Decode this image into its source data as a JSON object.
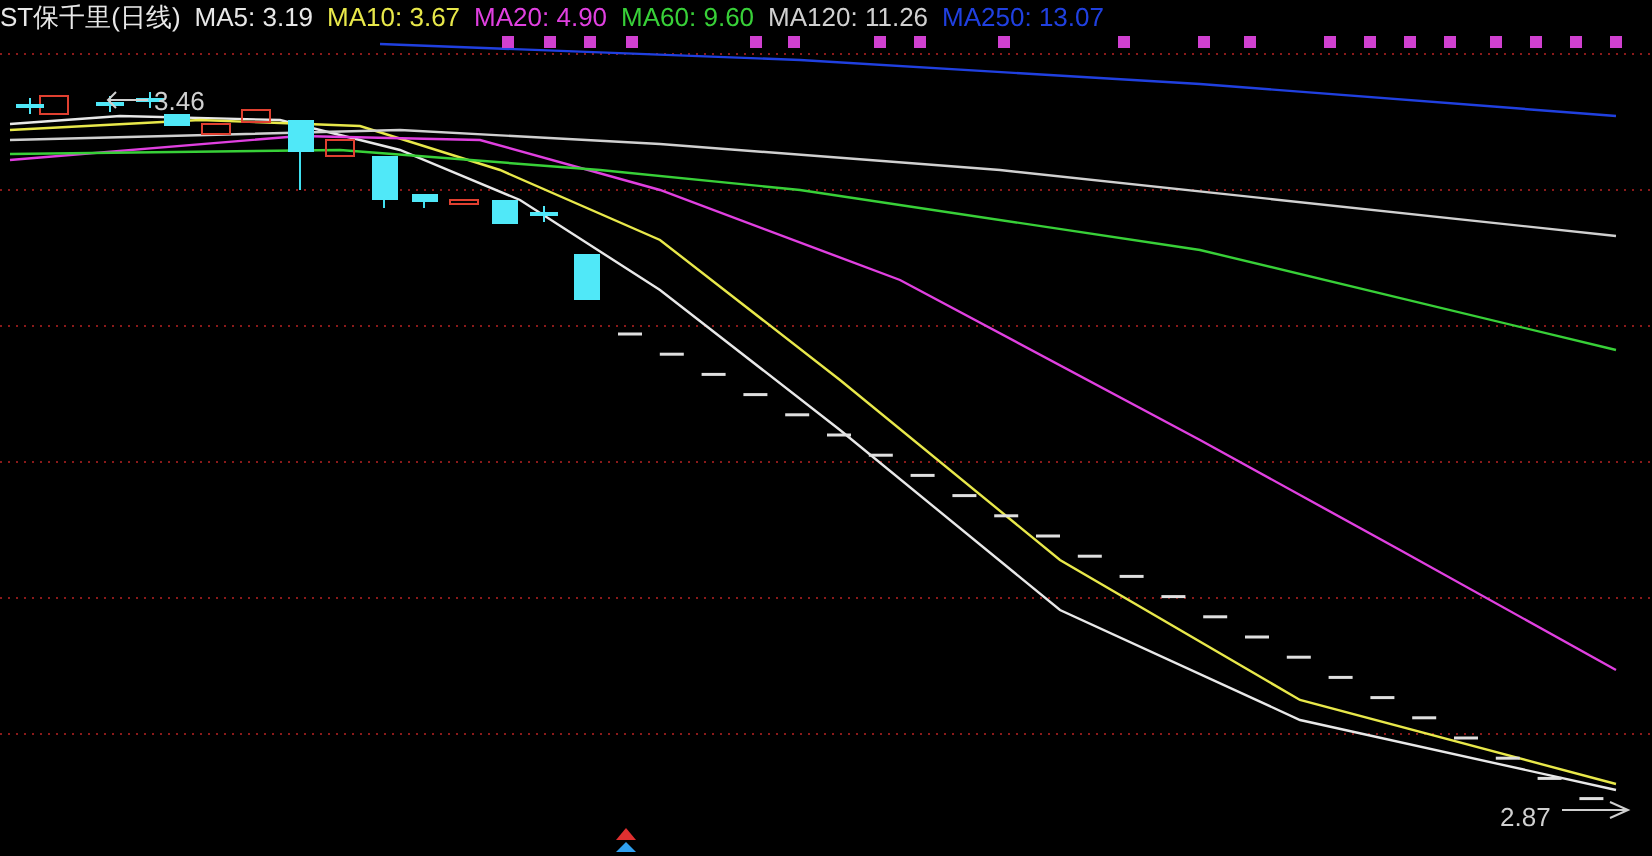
{
  "chart_title": "ST保千里(日线)",
  "indicators": [
    {
      "text": "MA5: 3.19",
      "color": "#e8e8e8"
    },
    {
      "text": "MA10: 3.67",
      "color": "#e8e84a"
    },
    {
      "text": "MA20: 4.90",
      "color": "#e040e0"
    },
    {
      "text": "MA60: 9.60",
      "color": "#38d038"
    },
    {
      "text": "MA120: 11.26",
      "color": "#d0d0d0"
    },
    {
      "text": "MA250: 13.07",
      "color": "#2040e0"
    }
  ],
  "high_label": "3.46",
  "low_label": "2.87"
}
